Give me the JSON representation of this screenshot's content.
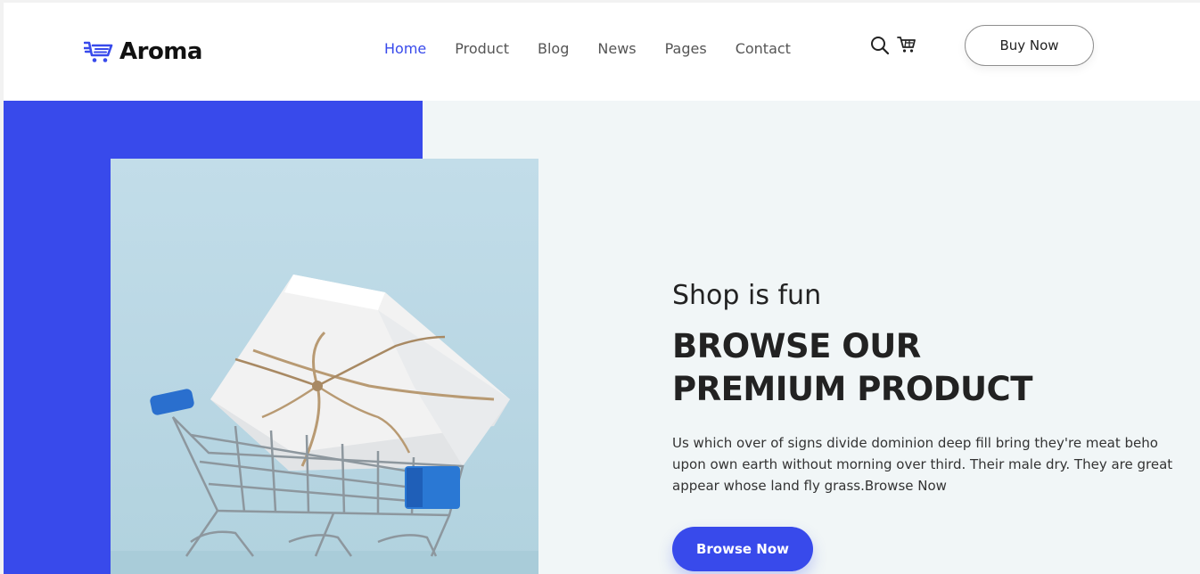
{
  "brand": {
    "name": "Aroma",
    "icon": "cart-logo-icon",
    "accent": "#384aeb"
  },
  "nav": {
    "items": [
      {
        "label": "Home",
        "active": true
      },
      {
        "label": "Product",
        "active": false
      },
      {
        "label": "Blog",
        "active": false
      },
      {
        "label": "News",
        "active": false
      },
      {
        "label": "Pages",
        "active": false
      },
      {
        "label": "Contact",
        "active": false
      }
    ]
  },
  "header": {
    "icons": [
      "search-icon",
      "cart-icon"
    ],
    "buy_label": "Buy Now"
  },
  "hero": {
    "subtitle": "Shop is fun",
    "title_line1": "BROWSE OUR",
    "title_line2": "PREMIUM PRODUCT",
    "description": "Us which over of signs divide dominion deep fill bring they're meat beho upon own earth without morning over third. Their male dry. They are great appear whose land fly grass.Browse Now",
    "button_label": "Browse Now",
    "image": "shopping-cart-with-gift-box-image",
    "colors": {
      "block": "#384aeb",
      "background": "#f1f6f7"
    }
  }
}
